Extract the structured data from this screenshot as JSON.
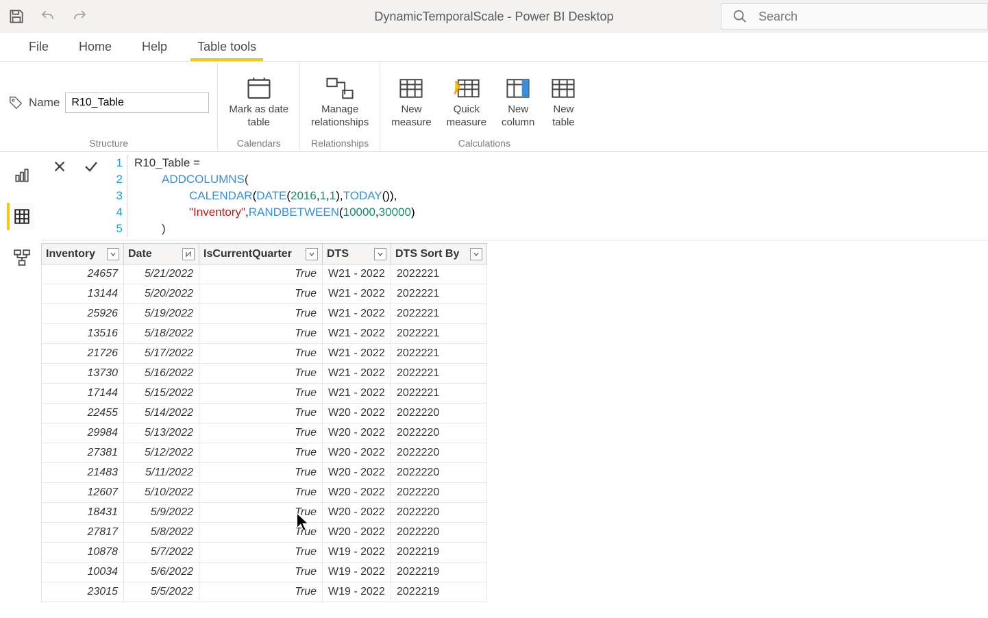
{
  "app": {
    "title": "DynamicTemporalScale - Power BI Desktop",
    "search_placeholder": "Search"
  },
  "tabs": {
    "file": "File",
    "home": "Home",
    "help": "Help",
    "table_tools": "Table tools"
  },
  "ribbon": {
    "name_label": "Name",
    "table_name": "R10_Table",
    "mark_date": "Mark as date\ntable",
    "manage_rel": "Manage\nrelationships",
    "new_measure": "New\nmeasure",
    "quick_measure": "Quick\nmeasure",
    "new_column": "New\ncolumn",
    "new_table": "New\ntable",
    "group_structure": "Structure",
    "group_calendars": "Calendars",
    "group_relationships": "Relationships",
    "group_calculations": "Calculations"
  },
  "formula": {
    "l1_a": "R10_Table ",
    "l2_a": "ADDCOLUMNS",
    "l3_a": "CALENDAR",
    "l3_b": "DATE",
    "l3_c": "2016",
    "l3_d": "1",
    "l3_e": "1",
    "l3_f": "TODAY",
    "l4_a": "\"Inventory\"",
    "l4_b": "RANDBETWEEN",
    "l4_c": "10000",
    "l4_d": "30000",
    "l5_a": ")"
  },
  "table": {
    "columns": [
      "Inventory",
      "Date",
      "IsCurrentQuarter",
      "DTS",
      "DTS Sort By"
    ],
    "rows": [
      {
        "inv": "24657",
        "date": "5/21/2022",
        "icq": "True",
        "dts": "W21 - 2022",
        "sort": "2022221"
      },
      {
        "inv": "13144",
        "date": "5/20/2022",
        "icq": "True",
        "dts": "W21 - 2022",
        "sort": "2022221"
      },
      {
        "inv": "25926",
        "date": "5/19/2022",
        "icq": "True",
        "dts": "W21 - 2022",
        "sort": "2022221"
      },
      {
        "inv": "13516",
        "date": "5/18/2022",
        "icq": "True",
        "dts": "W21 - 2022",
        "sort": "2022221"
      },
      {
        "inv": "21726",
        "date": "5/17/2022",
        "icq": "True",
        "dts": "W21 - 2022",
        "sort": "2022221"
      },
      {
        "inv": "13730",
        "date": "5/16/2022",
        "icq": "True",
        "dts": "W21 - 2022",
        "sort": "2022221"
      },
      {
        "inv": "17144",
        "date": "5/15/2022",
        "icq": "True",
        "dts": "W21 - 2022",
        "sort": "2022221"
      },
      {
        "inv": "22455",
        "date": "5/14/2022",
        "icq": "True",
        "dts": "W20 - 2022",
        "sort": "2022220"
      },
      {
        "inv": "29984",
        "date": "5/13/2022",
        "icq": "True",
        "dts": "W20 - 2022",
        "sort": "2022220"
      },
      {
        "inv": "27381",
        "date": "5/12/2022",
        "icq": "True",
        "dts": "W20 - 2022",
        "sort": "2022220"
      },
      {
        "inv": "21483",
        "date": "5/11/2022",
        "icq": "True",
        "dts": "W20 - 2022",
        "sort": "2022220"
      },
      {
        "inv": "12607",
        "date": "5/10/2022",
        "icq": "True",
        "dts": "W20 - 2022",
        "sort": "2022220"
      },
      {
        "inv": "18431",
        "date": "5/9/2022",
        "icq": "True",
        "dts": "W20 - 2022",
        "sort": "2022220"
      },
      {
        "inv": "27817",
        "date": "5/8/2022",
        "icq": "True",
        "dts": "W20 - 2022",
        "sort": "2022220"
      },
      {
        "inv": "10878",
        "date": "5/7/2022",
        "icq": "True",
        "dts": "W19 - 2022",
        "sort": "2022219"
      },
      {
        "inv": "10034",
        "date": "5/6/2022",
        "icq": "True",
        "dts": "W19 - 2022",
        "sort": "2022219"
      },
      {
        "inv": "23015",
        "date": "5/5/2022",
        "icq": "True",
        "dts": "W19 - 2022",
        "sort": "2022219"
      }
    ]
  }
}
